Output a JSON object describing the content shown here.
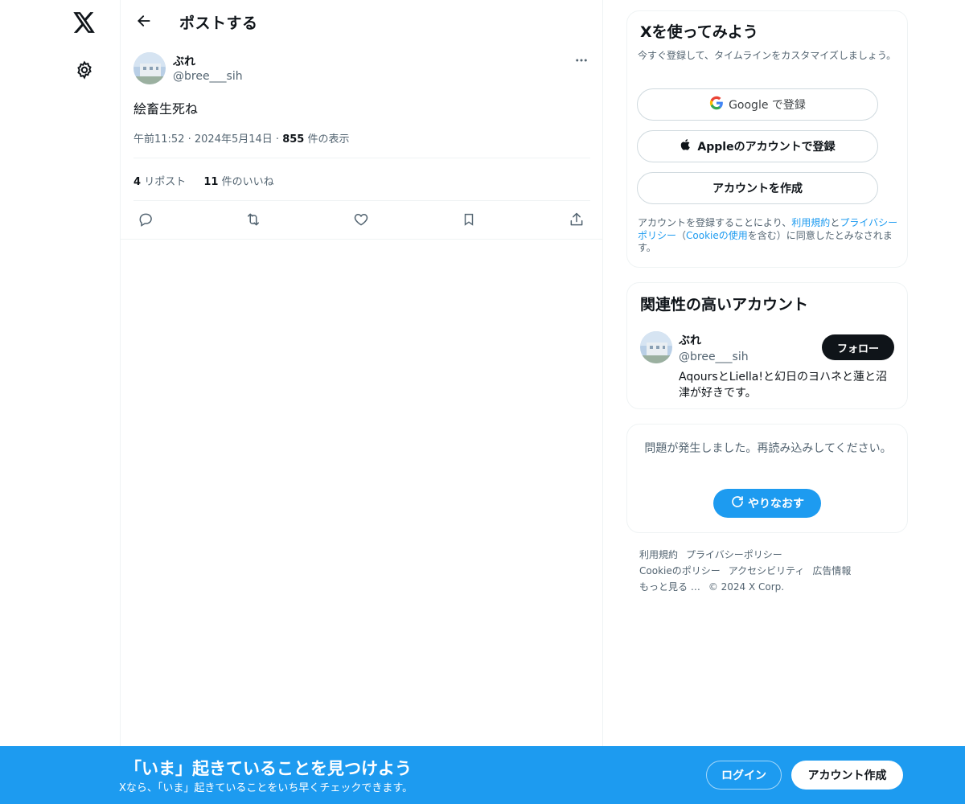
{
  "colors": {
    "accent": "#1d9bf0",
    "text": "#0f1419",
    "muted": "#536471",
    "border": "#eff3f4",
    "dark_button": "#0f1419"
  },
  "nav": {
    "icons": [
      "x-logo-icon",
      "gear-icon"
    ]
  },
  "header": {
    "title": "ポストする"
  },
  "post": {
    "author_name": "ぶれ",
    "author_handle": "@bree___sih",
    "text": "絵畜生死ね",
    "time": "午前11:52",
    "date": "2024年5月14日",
    "views_count": "855",
    "views_label": "件の表示",
    "reposts_count": "4",
    "reposts_label": "リポスト",
    "likes_count": "11",
    "likes_label": "件のいいね"
  },
  "signup_card": {
    "title": "Xを使ってみよう",
    "subtitle": "今すぐ登録して、タイムラインをカスタマイズしましょう。",
    "google_label": "Google で登録",
    "apple_label": "Appleのアカウントで登録",
    "create_label": "アカウントを作成",
    "legal_prefix": "アカウントを登録することにより、",
    "terms_link": "利用規約",
    "and": "と",
    "privacy_link": "プライバシーポリシー",
    "paren_open": "（",
    "cookie_link": "Cookieの使用",
    "legal_suffix": "を含む）に同意したとみなされます。"
  },
  "relevant": {
    "title": "関連性の高いアカウント",
    "name": "ぶれ",
    "handle": "@bree___sih",
    "bio": "AqoursとLiella!と幻日のヨハネと蓮と沼津が好きです。",
    "follow_label": "フォロー"
  },
  "error_card": {
    "message": "問題が発生しました。再読み込みしてください。",
    "retry_label": "やりなおす"
  },
  "footer": {
    "links": [
      "利用規約",
      "プライバシーポリシー",
      "Cookieのポリシー",
      "アクセシビリティ",
      "広告情報",
      "もっと見る …"
    ],
    "copyright": "© 2024 X Corp."
  },
  "banner": {
    "title": "「いま」起きていることを見つけよう",
    "subtitle": "Xなら、「いま」起きていることをいち早くチェックできます。",
    "login_label": "ログイン",
    "signup_label": "アカウント作成"
  }
}
